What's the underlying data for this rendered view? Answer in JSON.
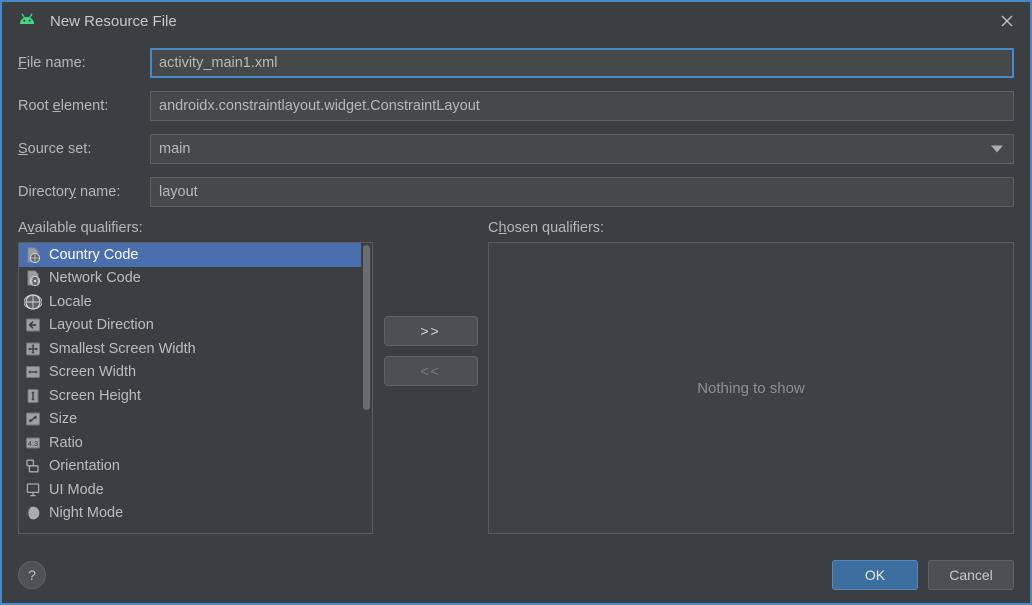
{
  "window": {
    "title": "New Resource File",
    "icon": "android-robot-icon",
    "close_icon": "close-icon",
    "accent_border_color": "#4a88c7",
    "background_color": "#3c3f41"
  },
  "form": {
    "file_name": {
      "label": "File name:",
      "mnemonic": "F",
      "value": "activity_main1.xml",
      "focused": true
    },
    "root_element": {
      "label": "Root element:",
      "mnemonic": "e",
      "value": "androidx.constraintlayout.widget.ConstraintLayout",
      "focused": false
    },
    "source_set": {
      "label": "Source set:",
      "mnemonic": "S",
      "value": "main",
      "arrow_icon": "chevron-down-icon"
    },
    "directory_name": {
      "label": "Directory name:",
      "mnemonic": "y",
      "value": "layout",
      "focused": false
    }
  },
  "qualifiers": {
    "available_label": "Available qualifiers:",
    "available_mnemonic": "v",
    "chosen_label": "Chosen qualifiers:",
    "chosen_mnemonic": "h",
    "selection_color": "#4b6eaf",
    "available_items": [
      {
        "label": "Country Code",
        "icon": "country-code-icon",
        "selected": true
      },
      {
        "label": "Network Code",
        "icon": "network-code-icon",
        "selected": false
      },
      {
        "label": "Locale",
        "icon": "globe-icon",
        "selected": false
      },
      {
        "label": "Layout Direction",
        "icon": "layout-direction-icon",
        "selected": false
      },
      {
        "label": "Smallest Screen Width",
        "icon": "smallest-screen-width-icon",
        "selected": false
      },
      {
        "label": "Screen Width",
        "icon": "screen-width-icon",
        "selected": false
      },
      {
        "label": "Screen Height",
        "icon": "screen-height-icon",
        "selected": false
      },
      {
        "label": "Size",
        "icon": "size-icon",
        "selected": false
      },
      {
        "label": "Ratio",
        "icon": "ratio-icon",
        "selected": false
      },
      {
        "label": "Orientation",
        "icon": "orientation-icon",
        "selected": false
      },
      {
        "label": "UI Mode",
        "icon": "ui-mode-icon",
        "selected": false
      },
      {
        "label": "Night Mode",
        "icon": "night-mode-icon",
        "selected": false
      }
    ],
    "add_button": {
      "label": ">>",
      "enabled": true
    },
    "remove_button": {
      "label": "<<",
      "enabled": false
    },
    "chosen_empty_text": "Nothing to show"
  },
  "footer": {
    "help_label": "?",
    "ok_label": "OK",
    "cancel_label": "Cancel",
    "ok_color": "#3c6e9f"
  }
}
